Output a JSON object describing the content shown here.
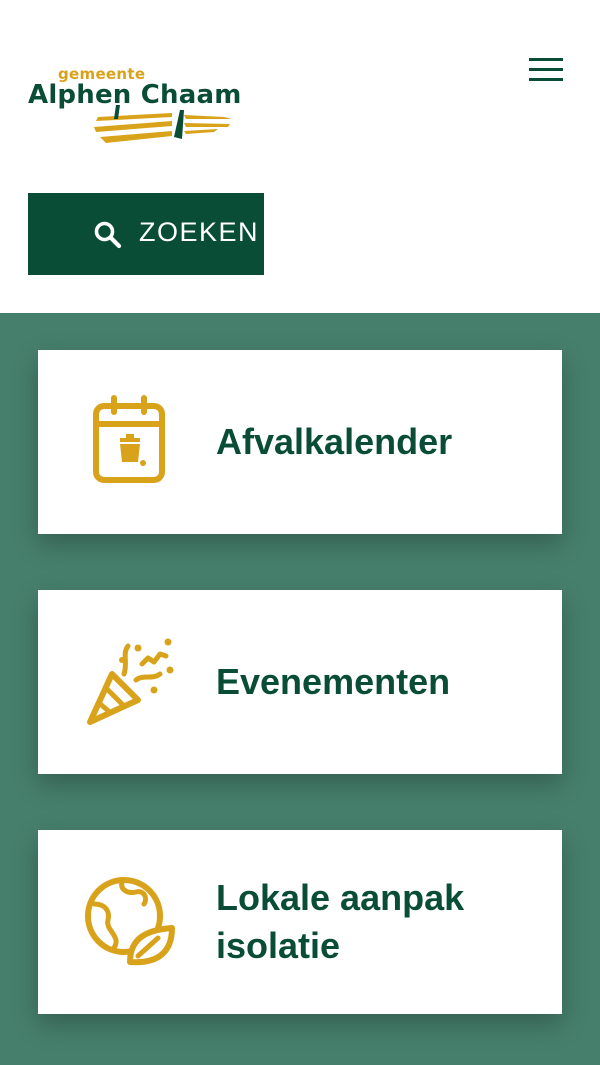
{
  "header": {
    "logo": {
      "small_text": "gemeente",
      "big_text": "Alphen Chaam"
    },
    "menu_icon": "hamburger-icon",
    "search": {
      "label": "ZOEKEN",
      "icon": "search-icon"
    }
  },
  "cards": [
    {
      "title": "Afvalkalender",
      "icon": "calendar-bin-icon"
    },
    {
      "title": "Evenementen",
      "icon": "party-popper-icon"
    },
    {
      "title": "Lokale aanpak isolatie",
      "icon": "globe-leaf-icon"
    }
  ],
  "colors": {
    "primary_green": "#0a4d36",
    "background_green": "#467f6c",
    "accent_gold": "#d9a21b",
    "card_background": "#ffffff"
  }
}
